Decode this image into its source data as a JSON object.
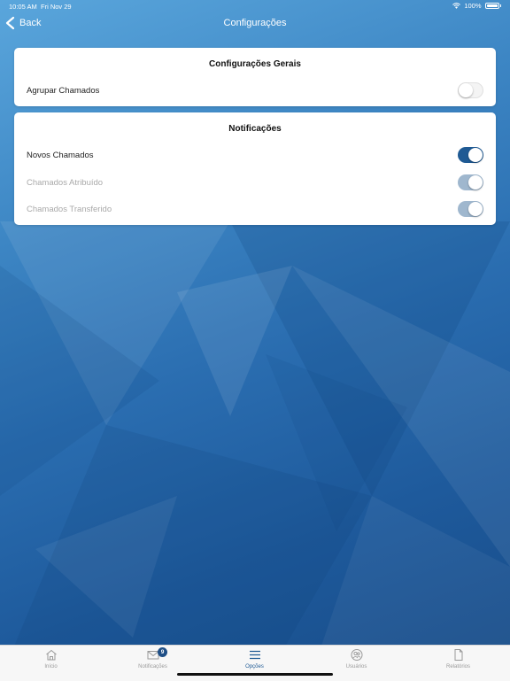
{
  "status_bar": {
    "time": "10:05 AM",
    "date": "Fri Nov 29",
    "battery": "100%"
  },
  "nav": {
    "back_label": "Back",
    "title": "Configurações"
  },
  "general_settings": {
    "header": "Configurações Gerais",
    "items": [
      {
        "label": "Agrupar Chamados",
        "enabled": false,
        "disabled": false
      }
    ]
  },
  "notifications": {
    "header": "Notificações",
    "items": [
      {
        "label": "Novos Chamados",
        "enabled": true,
        "disabled": false
      },
      {
        "label": "Chamados Atribuído",
        "enabled": true,
        "disabled": true
      },
      {
        "label": "Chamados Transferido",
        "enabled": true,
        "disabled": true
      }
    ]
  },
  "tab_bar": {
    "tabs": [
      {
        "label": "Início",
        "icon": "home-icon"
      },
      {
        "label": "Notificações",
        "icon": "mail-icon",
        "badge": "9"
      },
      {
        "label": "Opções",
        "icon": "menu-icon",
        "active": true
      },
      {
        "label": "Usuários",
        "icon": "users-icon"
      },
      {
        "label": "Relatórios",
        "icon": "document-icon"
      }
    ]
  },
  "colors": {
    "accent": "#1f5a94",
    "toggle_disabled": "#9fb7ce"
  }
}
